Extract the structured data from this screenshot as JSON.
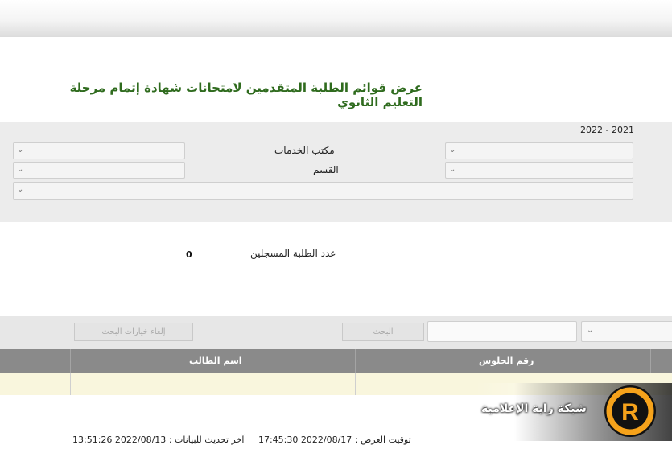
{
  "page": {
    "title": "عرض قوائم الطلبة المتقدمين لامتحانات شهادة إتمام مرحلة التعليم الثانوي"
  },
  "filters": {
    "year": "2022 - 2021",
    "office_label": "مكتب الخدمات",
    "section_label": "القسم",
    "office_value": "",
    "section_value": ""
  },
  "stats": {
    "registered_label": "عدد الطلبة المسجلين",
    "registered_count": "0"
  },
  "search": {
    "search_button": "البحث",
    "cancel_button": "إلغاء خيارات البحث",
    "input_value": ""
  },
  "table": {
    "columns": [
      "رقم الجلوس",
      "اسم الطالب"
    ],
    "rows": []
  },
  "footer": {
    "display_time_label": "توقيت العرض :",
    "display_time": "2022/08/17 17:45:30",
    "last_update_label": "آخر تحديث للبيانات :",
    "last_update": "2022/08/13 13:51:26"
  },
  "watermark": {
    "text": "شبكة راية الإعلامية",
    "logo_letter": "R"
  },
  "colors": {
    "title_green": "#2f6b1e",
    "header_gray": "#8a8a8a",
    "row_yellow": "#f9f6dd",
    "logo_orange": "#f5a21b"
  },
  "icons": {
    "dropdown": "chevron-down-icon"
  }
}
